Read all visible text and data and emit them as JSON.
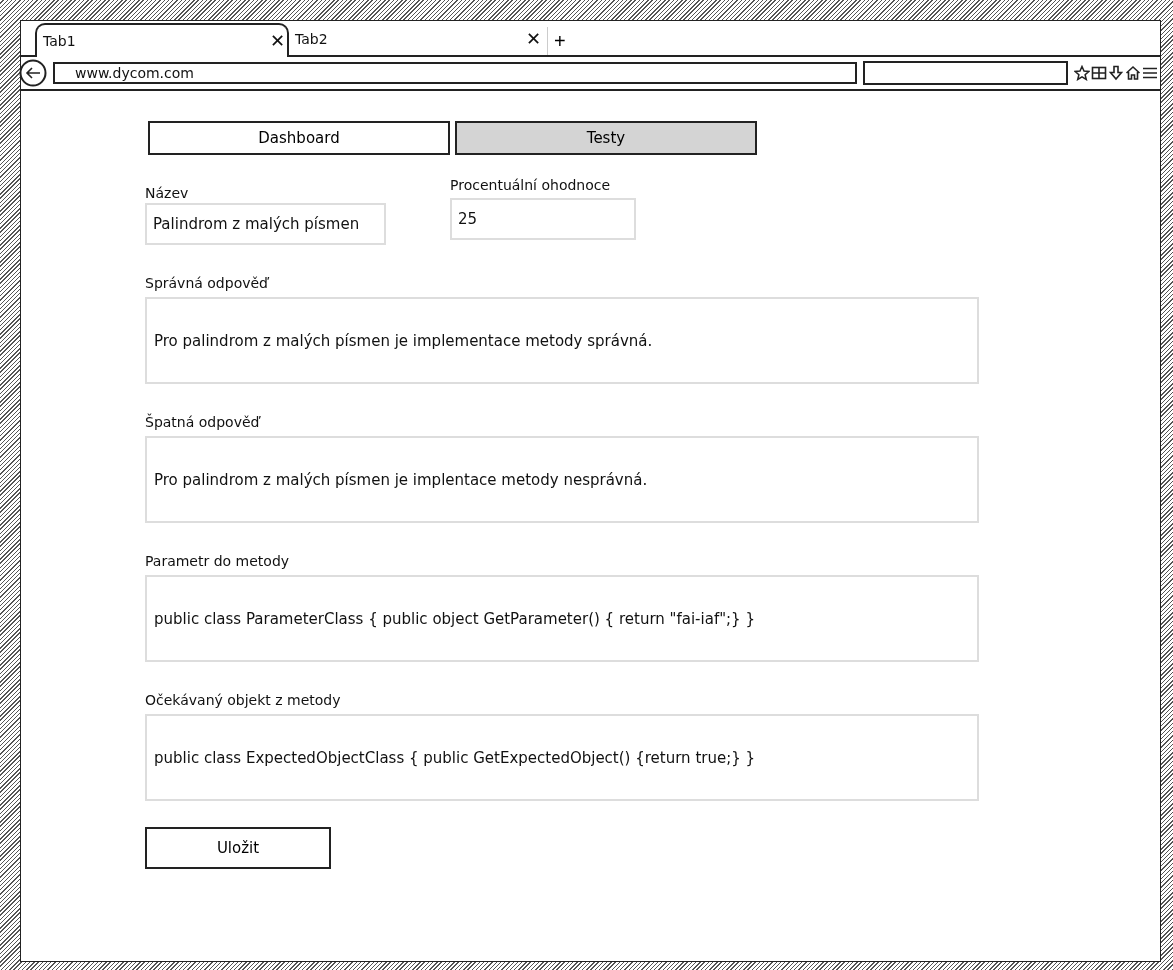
{
  "browser": {
    "tabs": [
      {
        "label": "Tab1",
        "close": "✕",
        "selected": true
      },
      {
        "label": "Tab2",
        "close": "✕",
        "selected": false
      }
    ],
    "new_tab": "+",
    "url": "www.dycom.com"
  },
  "nav": [
    {
      "label": "Dashboard",
      "selected": false
    },
    {
      "label": "Testy",
      "selected": true
    }
  ],
  "name_field": {
    "label": "Název",
    "value": "Palindrom z malých písmen"
  },
  "score_field": {
    "label": "Procentuální ohodnoce",
    "value": "25"
  },
  "text_fields": [
    {
      "label": "Správná odpověď",
      "value": "Pro palindrom z malých písmen je implementace metody správná."
    },
    {
      "label": "Špatná odpověď",
      "value": "Pro palindrom z  malých písmen je implentace metody nesprávná."
    },
    {
      "label": "Parametr do metody",
      "value": "public class ParameterClass { public object GetParameter() { return \"fai-iaf\";} }"
    },
    {
      "label": "Očekávaný objekt z metody",
      "value": "public class ExpectedObjectClass { public GetExpectedObject() {return true;} }"
    }
  ],
  "save_button": "Uložit"
}
